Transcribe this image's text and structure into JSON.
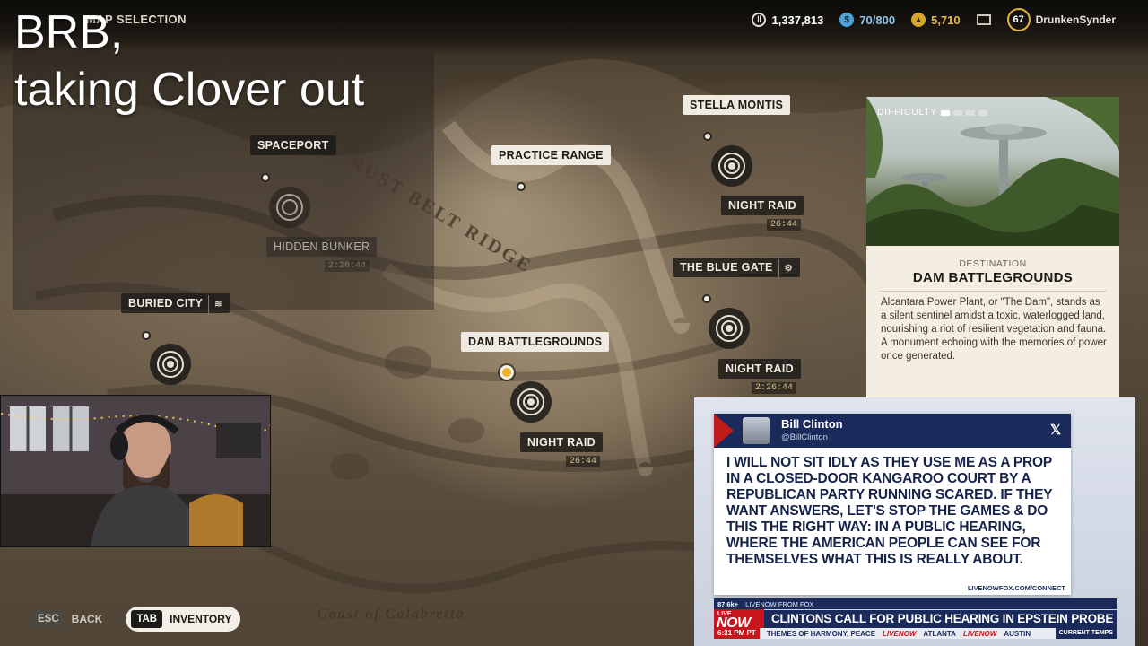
{
  "hud": {
    "screen_title": "MAP SELECTION",
    "credits": "1,337,813",
    "blue_currency": "70/800",
    "gold_currency": "5,710",
    "level": "67",
    "username": "DrunkenSynder"
  },
  "overlay": {
    "line1": "BRB,",
    "line2": "taking Clover out"
  },
  "map": {
    "region_labels": [
      "RUST BELT RIDGE",
      "Coast of Calabretta"
    ],
    "locations": {
      "spaceport": "SPACEPORT",
      "practice_range": "PRACTICE RANGE",
      "stella_montis": "STELLA MONTIS",
      "buried_city": "BURIED CITY",
      "the_blue_gate": "THE BLUE GATE",
      "dam_battlegrounds": "DAM BATTLEGROUNDS",
      "hidden_bunker": "HIDDEN BUNKER"
    },
    "events": {
      "stella_raid": "NIGHT RAID",
      "stella_timer": "26:44",
      "blue_gate_raid": "NIGHT RAID",
      "blue_gate_timer": "2:26:44",
      "dam_raid": "NIGHT RAID",
      "dam_timer": "26:44",
      "bunker_timer": "2:26:44"
    }
  },
  "destination": {
    "difficulty_label": "DIFFICULTY",
    "difficulty_level": 1,
    "difficulty_max": 4,
    "kicker": "DESTINATION",
    "name": "DAM BATTLEGROUNDS",
    "description": "Alcantara Power Plant, or \"The Dam\", stands as a silent sentinel amidst a toxic, waterlogged land, nourishing a riot of resilient vegetation and fauna. A monument echoing with the memories of power once generated."
  },
  "controls": {
    "back_key": "ESC",
    "back_label": "BACK",
    "inventory_key": "TAB",
    "inventory_label": "INVENTORY"
  },
  "news": {
    "tweet_name": "Bill Clinton",
    "tweet_handle": "@BillClinton",
    "tweet_text": "I WILL NOT SIT IDLY AS THEY USE ME AS A PROP IN A CLOSED-DOOR KANGAROO COURT BY A REPUBLICAN PARTY RUNNING SCARED. IF THEY WANT ANSWERS, LET'S STOP THE GAMES & DO THIS THE RIGHT WAY: IN A PUBLIC HEARING, WHERE THE AMERICAN PEOPLE CAN SEE FOR THEMSELVES WHAT THIS IS REALLY ABOUT.",
    "tweet_url": "LIVENOWFOX.COM/CONNECT",
    "viewers": "87.6k+",
    "source": "LIVENOW FROM FOX",
    "live_tag": "LIVE",
    "now_label": "NOW",
    "headline": "CLINTONS CALL FOR PUBLIC HEARING IN EPSTEIN PROBE",
    "time": "6:31 PM PT",
    "ticker_text": "THEMES OF HARMONY, PEACE",
    "ticker_logo": "LIVENOW",
    "ticker_city1": "ATLANTA",
    "ticker_city2": "AUSTIN",
    "ticker_temps": "CURRENT TEMPS"
  },
  "colors": {
    "accent_gold": "#e8b52a",
    "news_navy": "#1a2b5b",
    "news_red": "#c8141b",
    "card_bg": "#f3ede2"
  }
}
